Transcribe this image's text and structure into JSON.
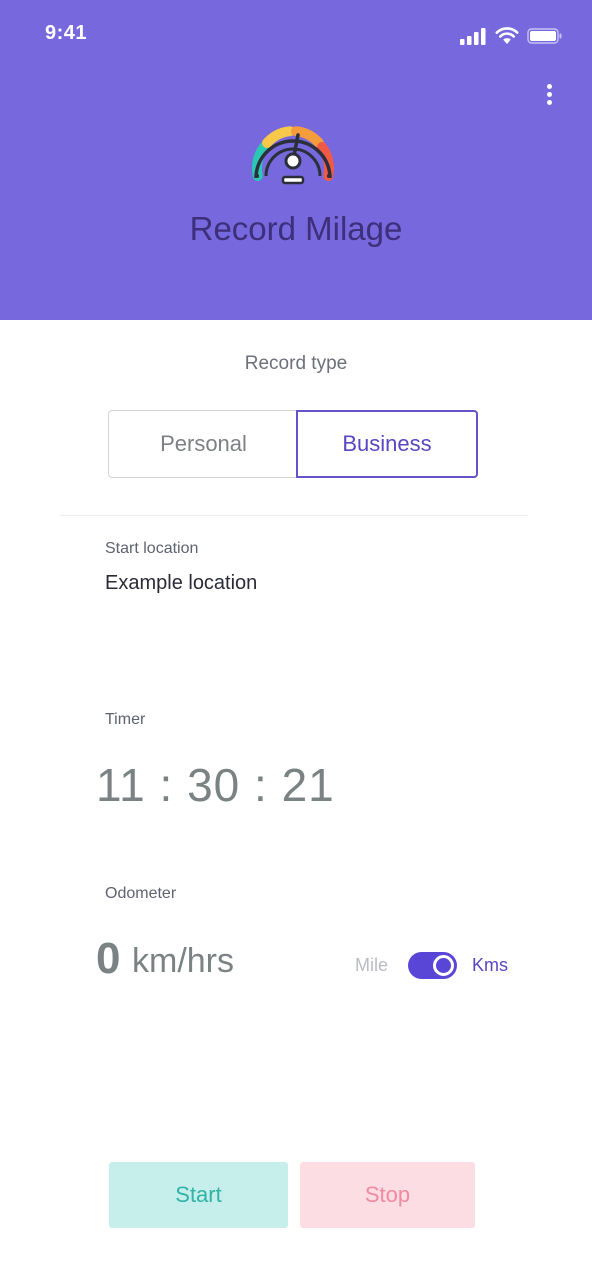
{
  "status_bar": {
    "time": "9:41"
  },
  "header": {
    "title": "Record Milage",
    "background_color": "#7768de",
    "gauge_icon": "speedometer-icon",
    "menu_icon": "more-vertical-icon"
  },
  "record_type": {
    "label": "Record type",
    "options": [
      "Personal",
      "Business"
    ],
    "selected": "Business"
  },
  "start_location": {
    "label": "Start location",
    "value": "Example location"
  },
  "timer": {
    "label": "Timer",
    "value": "11 : 30 : 21"
  },
  "odometer": {
    "label": "Odometer",
    "value": "0",
    "unit": "km/hrs",
    "toggle_off_label": "Mile",
    "toggle_on_label": "Kms",
    "toggle_on": true
  },
  "actions": {
    "start_label": "Start",
    "stop_label": "Stop",
    "start_color": "#c6eeea",
    "stop_color": "#fcdde3"
  }
}
